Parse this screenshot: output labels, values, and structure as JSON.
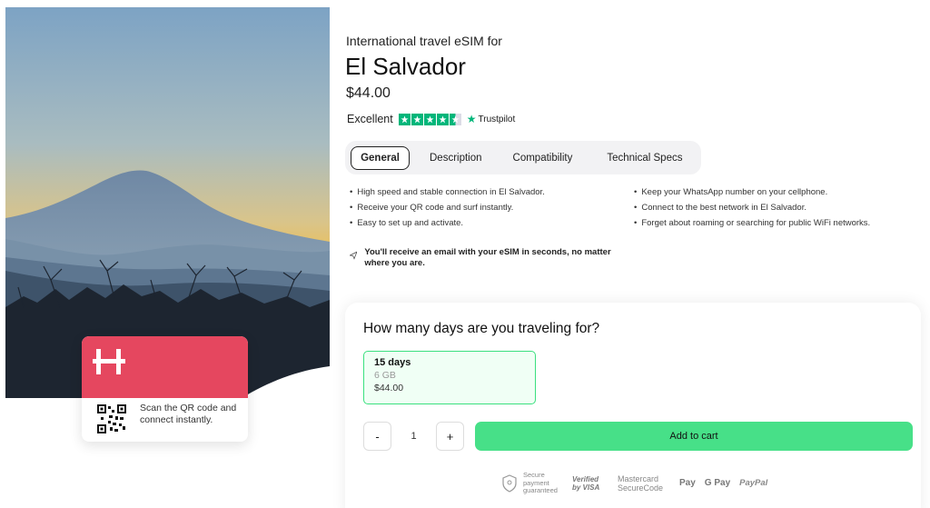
{
  "product": {
    "subtitle": "International travel eSIM for",
    "title": "El Salvador",
    "price": "$44.00"
  },
  "trustpilot": {
    "rating_label": "Excellent",
    "stars": 4.5,
    "logo_text": "Trustpilot"
  },
  "tabs": [
    {
      "label": "General",
      "active": true
    },
    {
      "label": "Description",
      "active": false
    },
    {
      "label": "Compatibility",
      "active": false
    },
    {
      "label": "Technical Specs",
      "active": false
    }
  ],
  "features": {
    "left": [
      "High speed and stable connection in El Salvador.",
      "Receive your QR code and surf instantly.",
      "Easy to set up and activate."
    ],
    "right": [
      "Keep your WhatsApp number on your cellphone.",
      "Connect to the best network in El Salvador.",
      "Forget about roaming or searching for public WiFi networks."
    ]
  },
  "email_note": "You'll receive an email with your eSIM in seconds, no matter where you are.",
  "qr_card": {
    "text": "Scan the QR code and connect instantly."
  },
  "purchase": {
    "question": "How many days are you traveling for?",
    "plan": {
      "days": "15 days",
      "data": "6 GB",
      "price": "$44.00"
    },
    "quantity": "1",
    "minus_label": "-",
    "plus_label": "+",
    "add_to_cart": "Add to cart"
  },
  "payments": {
    "secure_text": "Secure payment guaranteed",
    "visa": "Verified by VISA",
    "mastercard": "Mastercard SecureCode",
    "apple_pay": "Pay",
    "google_pay": "G Pay",
    "paypal": "PayPal"
  },
  "colors": {
    "brand_red": "#e5475f",
    "cta_green": "#47e088",
    "trust_green": "#00b67a"
  }
}
